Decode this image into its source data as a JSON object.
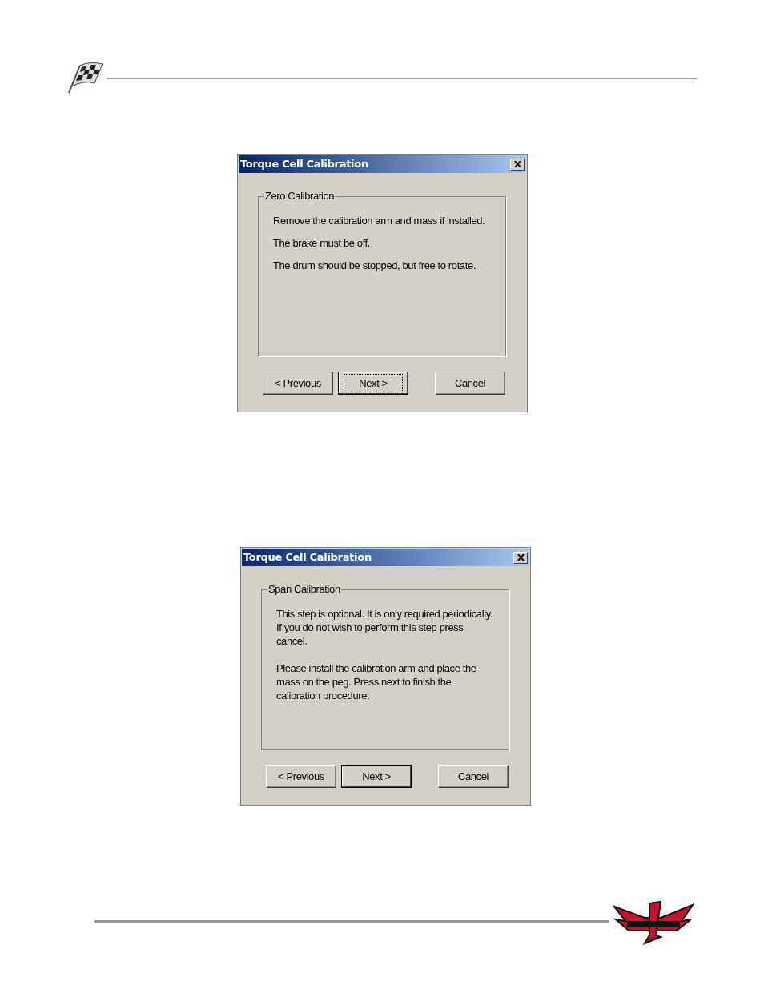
{
  "dialogs": [
    {
      "title": "Torque Cell Calibration",
      "group_label": "Zero Calibration",
      "paragraphs": [
        "Remove the calibration arm and mass if installed.",
        "The brake must be off.",
        "The drum should be stopped, but free to rotate."
      ],
      "buttons": [
        {
          "label": "< Previous",
          "default": false,
          "focused": false
        },
        {
          "label": "Next >",
          "default": true,
          "focused": true
        },
        {
          "label": "Cancel",
          "default": false,
          "focused": false
        }
      ]
    },
    {
      "title": "Torque Cell Calibration",
      "group_label": "Span Calibration",
      "paragraphs": [
        "This step is optional.  It is only required periodically.\n If you do not wish to perform this step press\ncancel.",
        "Please install the calibration arm and place the\nmass on the peg.  Press next to finish the\ncalibration procedure."
      ],
      "buttons": [
        {
          "label": "< Previous",
          "default": false,
          "focused": false
        },
        {
          "label": "Next >",
          "default": true,
          "focused": false
        },
        {
          "label": "Cancel",
          "default": false,
          "focused": false
        }
      ]
    }
  ]
}
